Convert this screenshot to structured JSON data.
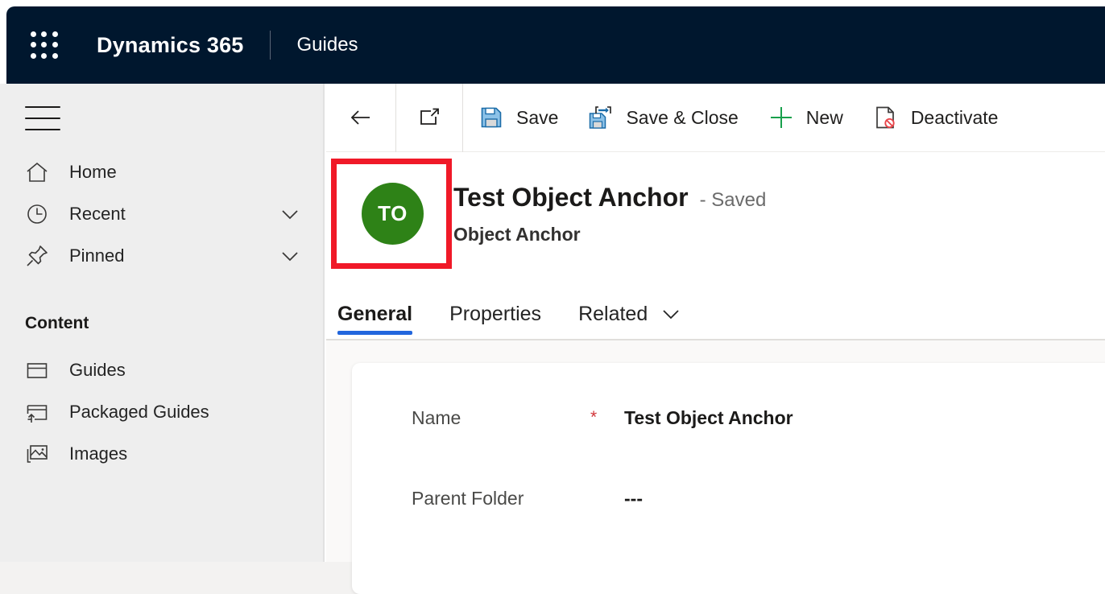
{
  "topbar": {
    "waffle_icon": "waffle-grid-icon",
    "brand": "Dynamics 365",
    "app_name": "Guides"
  },
  "sidebar": {
    "menu_icon": "hamburger-icon",
    "items": [
      {
        "label": "Home",
        "icon": "home-icon",
        "chevron": false
      },
      {
        "label": "Recent",
        "icon": "clock-icon",
        "chevron": true
      },
      {
        "label": "Pinned",
        "icon": "pin-icon",
        "chevron": true
      }
    ],
    "section_header": "Content",
    "content_items": [
      {
        "label": "Guides",
        "icon": "guide-window-icon"
      },
      {
        "label": "Packaged Guides",
        "icon": "packaged-guide-icon"
      },
      {
        "label": "Images",
        "icon": "images-icon"
      }
    ]
  },
  "commandbar": {
    "back_label": "Back",
    "open_label": "Open in new window",
    "items": [
      {
        "label": "Save",
        "icon": "save-floppy-icon"
      },
      {
        "label": "Save & Close",
        "icon": "save-and-close-icon"
      },
      {
        "label": "New",
        "icon": "plus-icon"
      },
      {
        "label": "Deactivate",
        "icon": "deactivate-document-icon"
      }
    ]
  },
  "record": {
    "avatar_initials": "TO",
    "avatar_color": "#2e8217",
    "title": "Test Object Anchor",
    "save_state": "- Saved",
    "subtitle": "Object Anchor",
    "highlight_color": "#f01928"
  },
  "tabs": [
    {
      "label": "General",
      "active": true,
      "chevron": false
    },
    {
      "label": "Properties",
      "active": false,
      "chevron": false
    },
    {
      "label": "Related",
      "active": false,
      "chevron": true
    }
  ],
  "form": {
    "fields": [
      {
        "label": "Name",
        "required": "*",
        "value": "Test Object Anchor"
      },
      {
        "label": "Parent Folder",
        "required": "",
        "value": "---"
      }
    ]
  },
  "accent": {
    "tab_indicator": "#2266dd",
    "navy": "#00172e",
    "required_red": "#d13438",
    "new_green": "#0e9c4a"
  }
}
